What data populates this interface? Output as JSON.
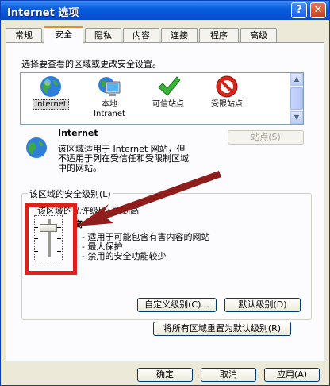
{
  "window": {
    "title": "Internet 选项",
    "help_btn": "?",
    "close_btn": "✕"
  },
  "tabs": [
    "常规",
    "安全",
    "隐私",
    "内容",
    "连接",
    "程序",
    "高级"
  ],
  "prompt": "选择要查看的区域或更改安全设置。",
  "zones": [
    {
      "label": "Internet",
      "icon": "globe-icon"
    },
    {
      "label": "本地\nIntranet",
      "icon": "monitor-icon"
    },
    {
      "label": "可信站点",
      "icon": "check-icon"
    },
    {
      "label": "受限站点",
      "icon": "no-entry-icon"
    }
  ],
  "zone_info": {
    "title": "Internet",
    "desc": "该区域适用于 Internet 网站，但\n不适用于列在受信任和受限制区域\n中的网站。",
    "sites_btn": "站点(S)"
  },
  "security_level": {
    "group_title": "该区域的安全级别(L)",
    "allowed": "该区域的允许级别: 中到高",
    "level": "高",
    "bullets": [
      "- 适用于可能包含有害内容的网站",
      "- 最大保护",
      "- 禁用的安全功能较少"
    ],
    "custom_btn": "自定义级别(C)...",
    "default_btn": "默认级别(D)",
    "reset_btn": "将所有区域重置为默认级别(R)"
  },
  "footer": {
    "ok": "确定",
    "cancel": "取消",
    "apply": "应用(A)"
  },
  "colors": {
    "title_blue": "#0653d6",
    "highlight_red": "#e0201b",
    "arrow": "#8e1d1b"
  }
}
